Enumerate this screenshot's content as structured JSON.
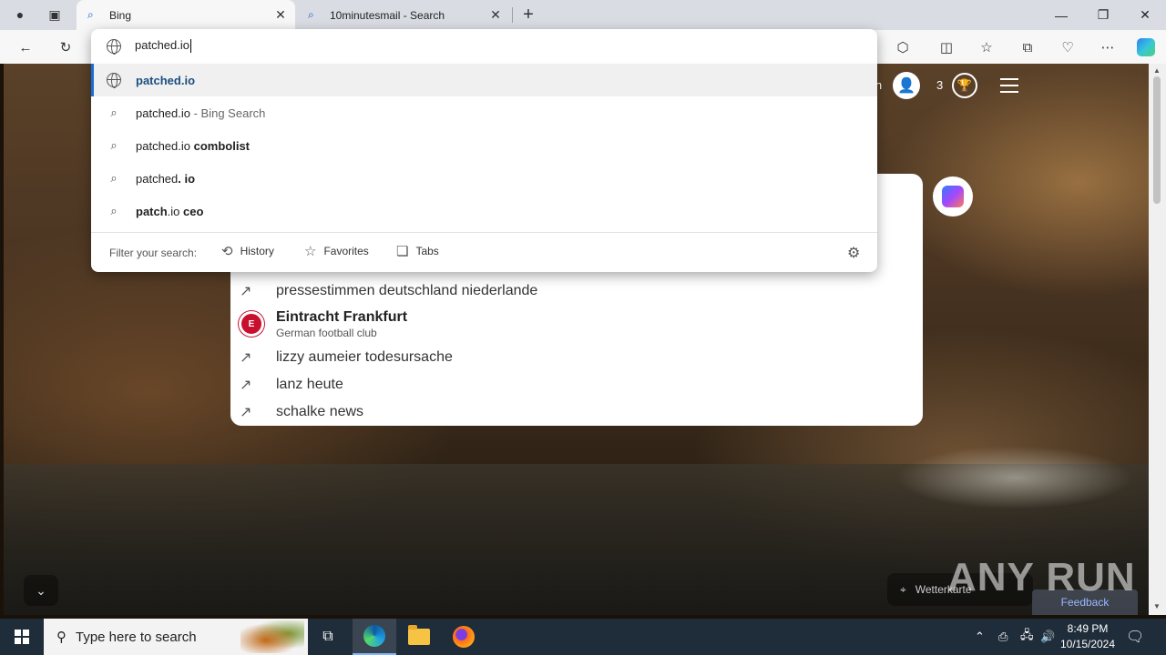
{
  "browser": {
    "tabs": [
      {
        "title": "Bing",
        "active": true
      },
      {
        "title": "10minutesmail - Search",
        "active": false
      }
    ],
    "new_tab_symbol": "+",
    "window_controls": {
      "minimize": "—",
      "maximize": "❐",
      "close": "✕"
    }
  },
  "omnibox": {
    "input_value": "patched.io",
    "suggestions": [
      {
        "icon": "globe-icon",
        "type": "url",
        "text": "patched.io"
      },
      {
        "icon": "search-icon",
        "prefix": "patched.io",
        "muted": " - Bing Search"
      },
      {
        "icon": "search-icon",
        "prefix": "patched.io ",
        "bold": "combolist"
      },
      {
        "icon": "search-icon",
        "prefix": "patched",
        "bold": ". io"
      },
      {
        "icon": "search-icon",
        "bold_prefix": "patch",
        "middle": ".io ",
        "bold": "ceo"
      }
    ],
    "filter_label": "Filter your search:",
    "filters": [
      "History",
      "Favorites",
      "Tabs"
    ]
  },
  "bing": {
    "signin_tail": "in",
    "rewards_count": "3",
    "trending": [
      "pressestimmen deutschland niederlande",
      "lizzy aumeier todesursache",
      "lanz heute",
      "schalke news"
    ],
    "entity": {
      "title": "Eintracht Frankfurt",
      "subtitle": "German football club"
    },
    "weather_text": "Wetterkarte",
    "feedback": "Feedback",
    "watermark": "ANY RUN"
  },
  "taskbar": {
    "search_placeholder": "Type here to search",
    "time": "8:49 PM",
    "date": "10/15/2024"
  },
  "colors": {
    "accent": "#1a6dd6",
    "url_text": "#1c4e80",
    "taskbar": "#1f2c3a"
  }
}
